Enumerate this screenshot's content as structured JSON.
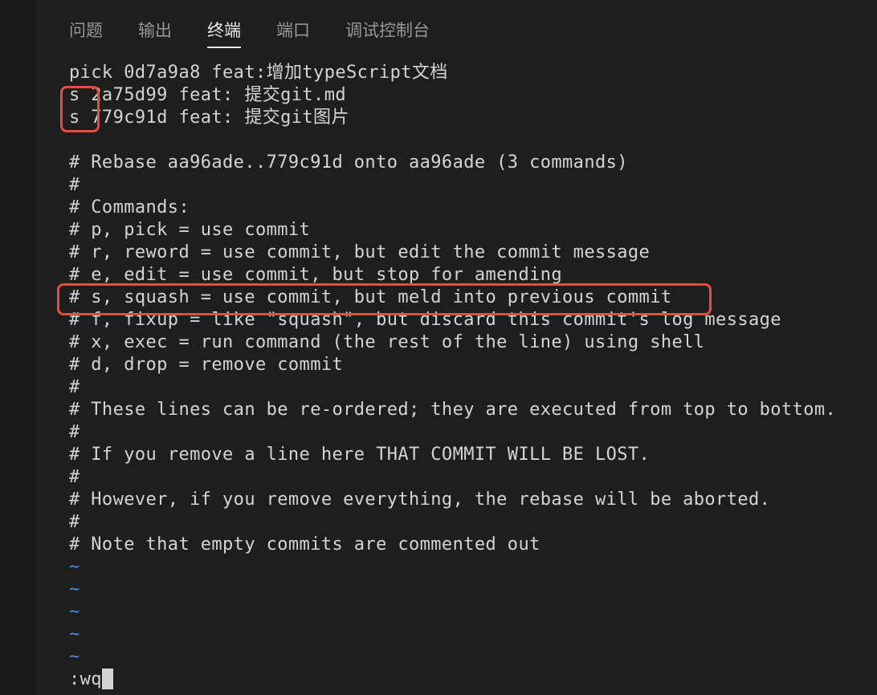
{
  "tabs": [
    {
      "label": "问题"
    },
    {
      "label": "输出"
    },
    {
      "label": "终端",
      "active": true
    },
    {
      "label": "端口"
    },
    {
      "label": "调试控制台"
    }
  ],
  "terminal": {
    "lines": [
      "pick 0d7a9a8 feat:增加typeScript文档",
      "s 2a75d99 feat: 提交git.md",
      "s 779c91d feat: 提交git图片",
      "",
      "# Rebase aa96ade..779c91d onto aa96ade (3 commands)",
      "#",
      "# Commands:",
      "# p, pick = use commit",
      "# r, reword = use commit, but edit the commit message",
      "# e, edit = use commit, but stop for amending",
      "# s, squash = use commit, but meld into previous commit",
      "# f, fixup = like \"squash\", but discard this commit's log message",
      "# x, exec = run command (the rest of the line) using shell",
      "# d, drop = remove commit",
      "#",
      "# These lines can be re-ordered; they are executed from top to bottom.",
      "#",
      "# If you remove a line here THAT COMMIT WILL BE LOST.",
      "#",
      "# However, if you remove everything, the rebase will be aborted.",
      "#",
      "# Note that empty commits are commented out",
      "~",
      "~",
      "~",
      "~",
      "~"
    ],
    "command_line": ":wq"
  },
  "colors": {
    "background": "#1e1e1e",
    "text": "#d4d4d4",
    "tilde": "#3b8eea",
    "annotation": "#e74c3c"
  }
}
